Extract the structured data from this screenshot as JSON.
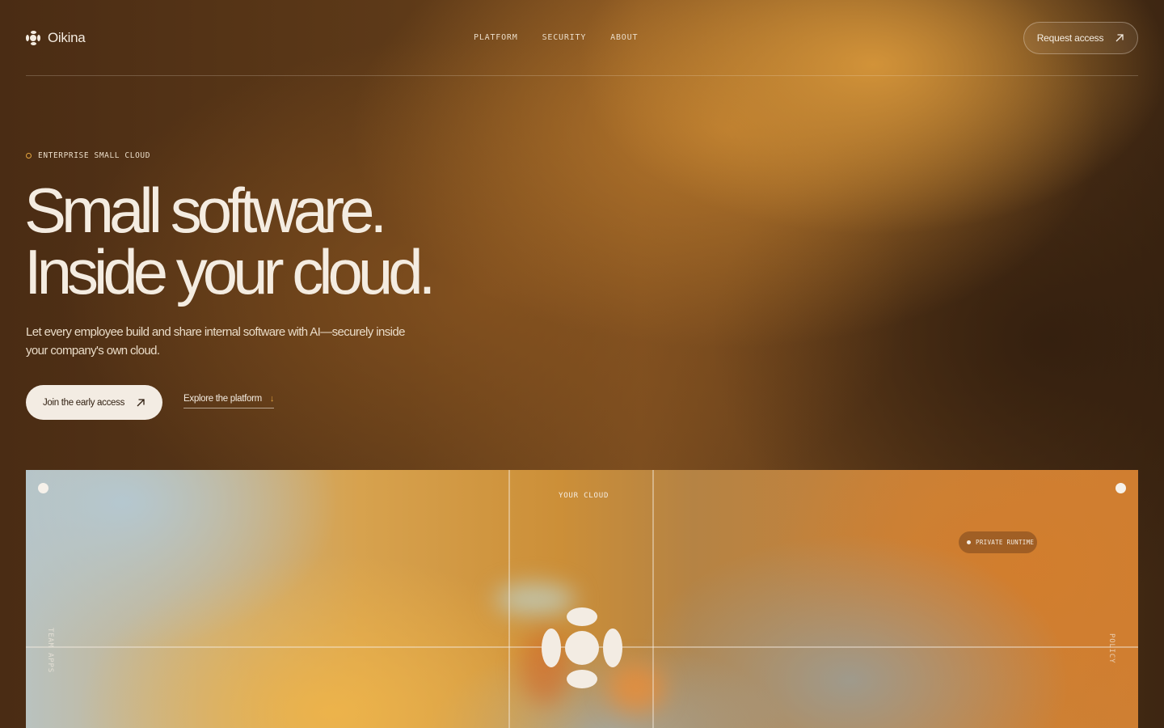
{
  "brand": {
    "name": "Oikina"
  },
  "nav": {
    "items": [
      "PLATFORM",
      "SECURITY",
      "ABOUT"
    ]
  },
  "header": {
    "request_access_label": "Request access"
  },
  "hero": {
    "eyebrow": "ENTERPRISE SMALL CLOUD",
    "headline_line1": "Small software.",
    "headline_line2": "Inside your cloud.",
    "subtitle": "Let every employee build and share internal software with AI—securely inside your company's own cloud.",
    "cta_primary": "Join the early access",
    "cta_secondary": "Explore the platform",
    "cta_secondary_icon": "↓"
  },
  "panel": {
    "label_top": "YOUR CLOUD",
    "label_left": "TEAM APPS",
    "label_right": "POLICY",
    "chip": "PRIVATE RUNTIME"
  },
  "colors": {
    "accent": "#e5a53f",
    "text": "#f4ece1",
    "button_bg": "#f3ece3",
    "button_text": "#2e1d0e"
  }
}
